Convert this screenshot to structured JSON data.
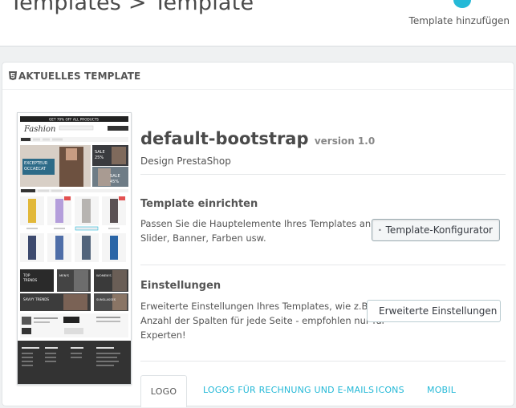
{
  "header": {
    "breadcrumb": "Templates > Template",
    "add_template_label": "Template hinzufügen"
  },
  "panel": {
    "heading": "AKTUELLES TEMPLATE"
  },
  "preview_thumb": {
    "logo": "Fashion",
    "banner": "GET 70% OFF ALL PRODUCTS",
    "slider_text": "EXCEPTEUR OCCAECAT",
    "sale_text": "SALE 25% OFF",
    "sale2_text": "SALE 45% OFF",
    "tiles": [
      "TOP TRENDS",
      "MEN'S COATS & JACKETS",
      "WOMEN'S COATS & JACKETS"
    ],
    "tiles2": [
      "SAVVY TRENDS",
      "SUNGLASSES"
    ]
  },
  "template": {
    "name": "default-bootstrap",
    "version": "version 1.0",
    "author": "Design PrestaShop"
  },
  "setup": {
    "title": "Template einrichten",
    "text_line1": "Passen Sie die Hauptelemente Ihres Templates an:",
    "text_line2": "Slider, Banner, Farben usw.",
    "button_label": "Template-Konfigurator"
  },
  "settings": {
    "title": "Einstellungen",
    "text_line1": "Erweiterte Einstellungen Ihres Templates, wie z.B.",
    "text_line2": "Anzahl der Spalten für jede Seite - empfohlen nur für",
    "text_line3": "Experten!",
    "button_label": "Erweiterte Einstellungen"
  },
  "tabs": [
    {
      "label": "LOGO"
    },
    {
      "label": "LOGOS FÜR RECHNUNG UND E-MAILS"
    },
    {
      "label": "ICONS"
    },
    {
      "label": "MOBIL"
    }
  ],
  "colors": {
    "accent": "#25b9d7",
    "background": "#eff1f2",
    "text": "#555555"
  }
}
